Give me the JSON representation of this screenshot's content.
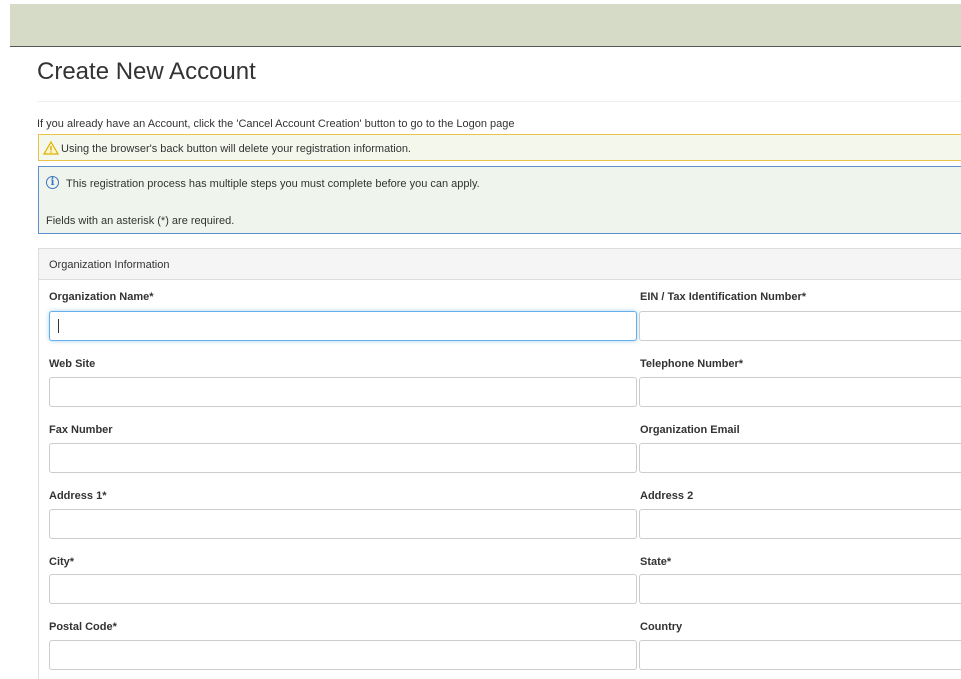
{
  "page": {
    "title": "Create New Account",
    "existing_account_note": "If you already have an Account, click the 'Cancel Account Creation' button to go to the Logon page"
  },
  "warning": {
    "icon": "warning-triangle-icon",
    "text": "Using the browser's back button will delete your registration information."
  },
  "info": {
    "icon": "info-circle-icon",
    "text": "This registration process has multiple steps you must complete before you can apply.",
    "required_note": "Fields with an asterisk (*) are required."
  },
  "section": {
    "title": "Organization Information",
    "fields": [
      {
        "label": "Organization Name*",
        "value": ""
      },
      {
        "label": "EIN / Tax Identification Number*",
        "value": ""
      },
      {
        "label": "Web Site",
        "value": ""
      },
      {
        "label": "Telephone Number*",
        "value": ""
      },
      {
        "label": "Fax Number",
        "value": ""
      },
      {
        "label": "Organization Email",
        "value": ""
      },
      {
        "label": "Address 1*",
        "value": ""
      },
      {
        "label": "Address 2",
        "value": ""
      },
      {
        "label": "City*",
        "value": ""
      },
      {
        "label": "State*",
        "value": ""
      },
      {
        "label": "Postal Code*",
        "value": ""
      },
      {
        "label": "Country",
        "value": ""
      }
    ]
  },
  "colors": {
    "topbar": "#d6dbc7",
    "warning_border": "#e8c54a",
    "info_border": "#5d8fd1",
    "focus_border": "#66afe9"
  }
}
